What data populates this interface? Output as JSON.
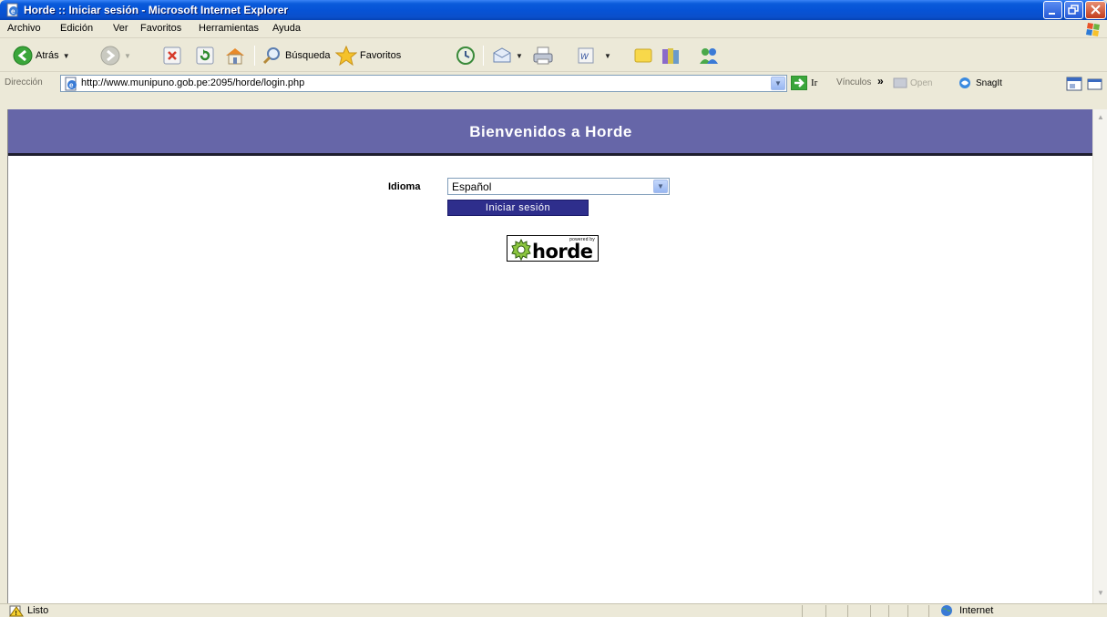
{
  "window": {
    "title": "Horde :: Iniciar sesión - Microsoft Internet Explorer"
  },
  "menu": [
    "Archivo",
    "Edición",
    "Ver",
    "Favoritos",
    "Herramientas",
    "Ayuda"
  ],
  "toolbar": {
    "back_label": "Atrás",
    "search_label": "Búsqueda",
    "favorites_label": "Favoritos"
  },
  "address_bar": {
    "label": "Dirección",
    "url": "http://www.munipuno.gob.pe:2095/horde/login.php",
    "go_label": "Ir",
    "links_label": "Vínculos",
    "open_label": "Open",
    "snagit_label": "SnagIt"
  },
  "page": {
    "heading": "Bienvenidos a Horde",
    "language_label": "Idioma",
    "language_value": "Español",
    "login_button": "Iniciar sesión",
    "logo": {
      "powered_by": "powered by",
      "wordmark": "horde"
    }
  },
  "status_bar": {
    "status": "Listo",
    "zone": "Internet"
  },
  "colors": {
    "horde_header": "#6666A8",
    "login_button": "#2E2E8C",
    "titlebar": "#0653D6"
  }
}
